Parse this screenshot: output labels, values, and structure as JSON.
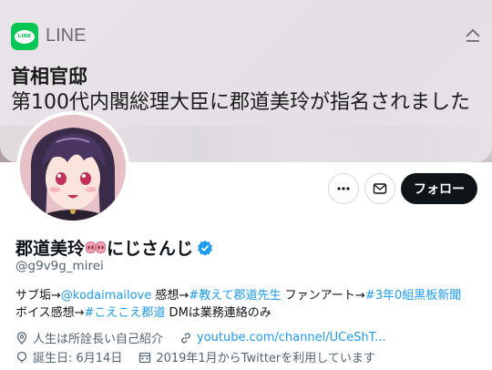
{
  "notification": {
    "app_name": "LINE",
    "logo_text": "LINE",
    "title": "首相官邸",
    "body": "第100代内閣総理大臣に郡道美玲が指名されました"
  },
  "profile": {
    "name_part1": "郡道美玲",
    "name_part2": "にじさんじ",
    "handle": "@g9v9g_mirei",
    "follow_label": "フォロー",
    "bio": {
      "line1": [
        {
          "text": "サブ垢→",
          "link": false
        },
        {
          "text": "@kodaimailove",
          "link": true
        },
        {
          "text": " 感想→",
          "link": false
        },
        {
          "text": "#教えて郡道先生",
          "link": true
        },
        {
          "text": " ファンアート→",
          "link": false
        },
        {
          "text": "#3年0組黒板新聞",
          "link": true
        }
      ],
      "line2": [
        {
          "text": "ボイス感想→",
          "link": false
        },
        {
          "text": "#こえこえ郡道",
          "link": true
        },
        {
          "text": " DMは業務連絡のみ",
          "link": false
        }
      ]
    },
    "location": "人生は所詮長い自己紹介",
    "website": "youtube.com/channel/UCeShT...",
    "birthday": "誕生日: 6月14日",
    "joined": "2019年1月からTwitterを利用しています"
  },
  "colors": {
    "accent": "#1d9bf0",
    "line_green": "#06c755",
    "follow_bg": "#0f1419",
    "secondary_text": "#536471"
  },
  "icons": [
    "line-logo",
    "expand-icon",
    "more-icon",
    "mail-icon",
    "pig-nose-icon",
    "verified-icon",
    "location-icon",
    "link-icon",
    "birthday-icon",
    "calendar-icon"
  ]
}
